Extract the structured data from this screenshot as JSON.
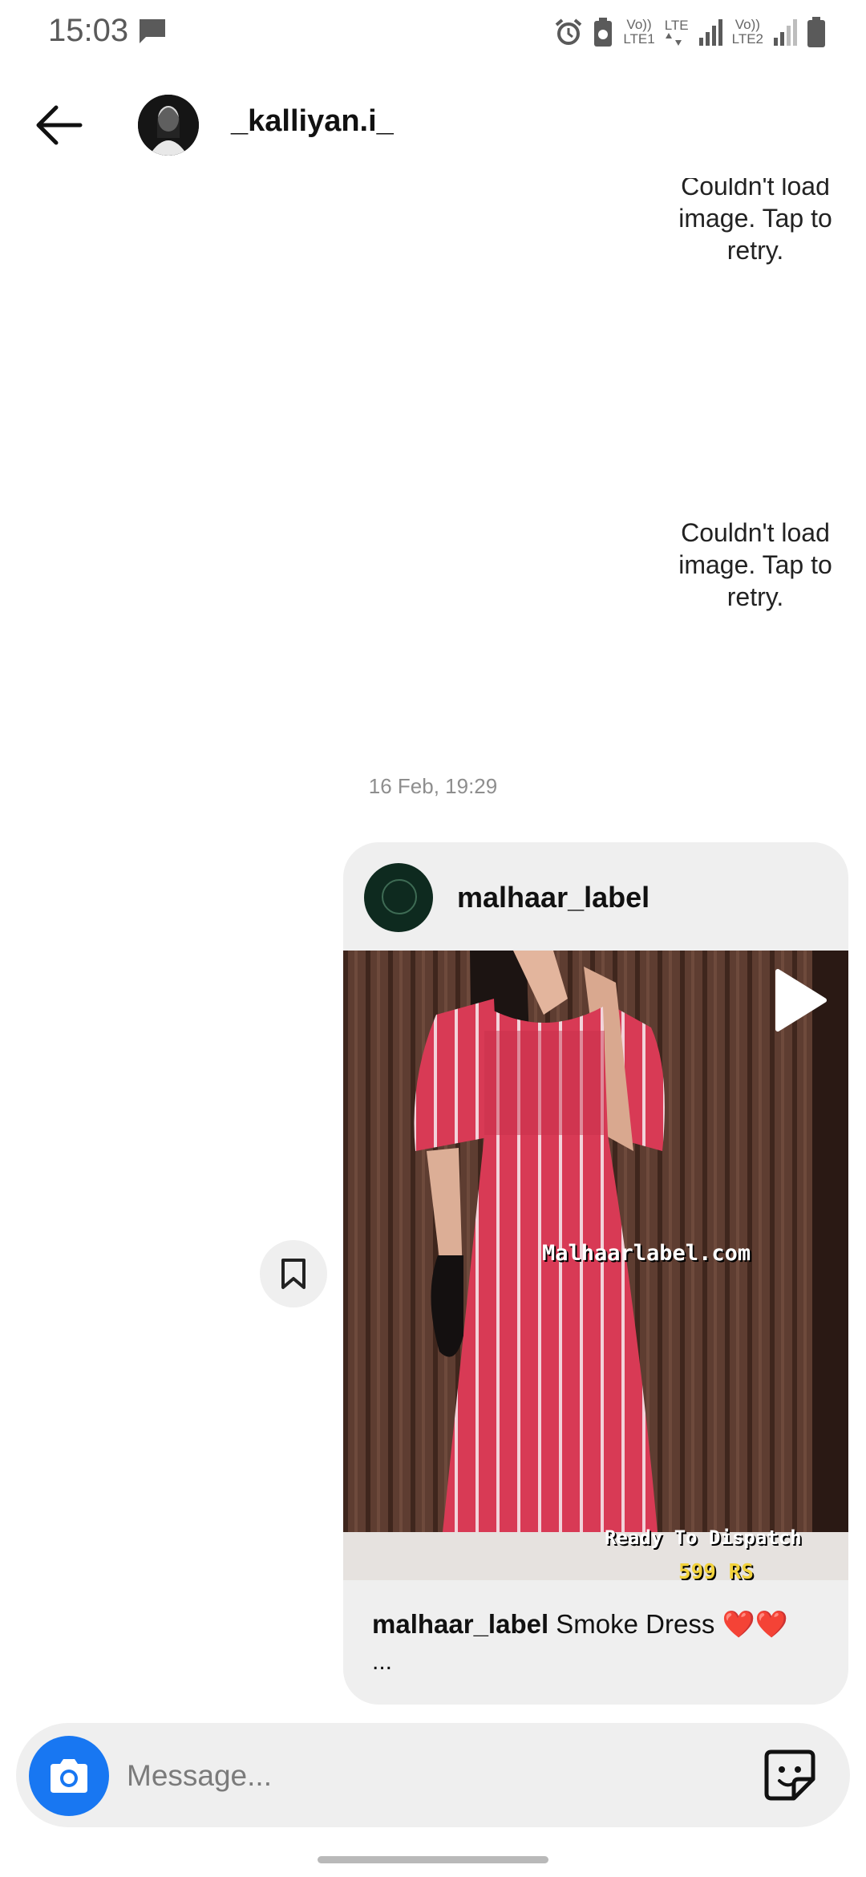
{
  "status_bar": {
    "time": "15:03",
    "icons": [
      "message-icon",
      "alarm-icon",
      "battery-saver-icon",
      "signal-lte1-icon",
      "lte-data-icon",
      "signal-lte2-icon",
      "battery-icon"
    ],
    "net1_top": "Vo))",
    "net1_bottom": "LTE1",
    "net_mid_top": "LTE",
    "net2_top": "Vo))",
    "net2_bottom": "LTE2"
  },
  "header": {
    "username": "_kalliyan.i_",
    "icons": [
      "back-arrow-icon",
      "avatar"
    ]
  },
  "messages": {
    "error_partial": "Couldn't load image. Tap to retry.",
    "error_full": "Couldn't load image. Tap to retry.",
    "timestamp": "16 Feb, 19:29"
  },
  "shared_post": {
    "username": "malhaar_label",
    "overlay_site": "Malhaarlabel.com",
    "overlay_status": "Ready To Dispatch",
    "overlay_price": "599 RS",
    "caption_user": "malhaar_label",
    "caption_text": "Smoke Dress",
    "caption_emoji": "❤️❤️",
    "caption_more": "...",
    "icons": [
      "play-icon"
    ]
  },
  "save_button": {
    "icon": "bookmark-icon"
  },
  "composer": {
    "placeholder": "Message...",
    "icons": [
      "camera-icon",
      "sticker-icon"
    ]
  },
  "colors": {
    "accent": "#1877f2",
    "bubble": "#efefef",
    "timestamp": "#8e8e8e",
    "heart": "#e0162b"
  }
}
